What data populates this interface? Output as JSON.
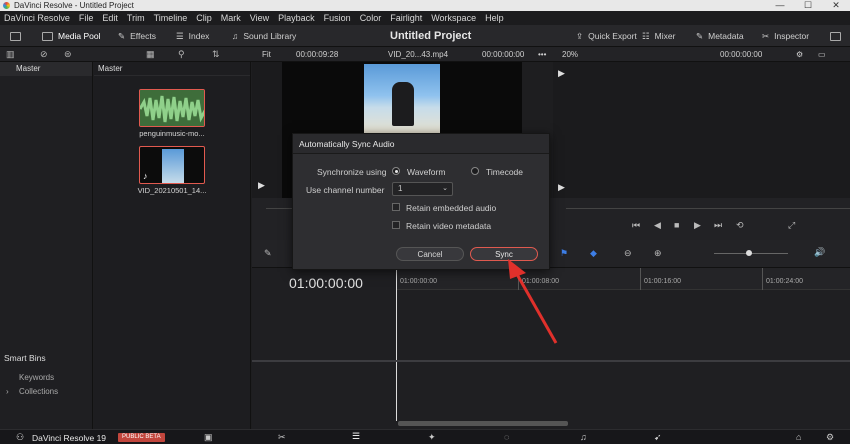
{
  "window": {
    "title": "DaVinci Resolve - Untitled Project"
  },
  "menu": [
    "DaVinci Resolve",
    "File",
    "Edit",
    "Trim",
    "Timeline",
    "Clip",
    "Mark",
    "View",
    "Playback",
    "Fusion",
    "Color",
    "Fairlight",
    "Workspace",
    "Help"
  ],
  "toolbar": {
    "media_pool": "Media Pool",
    "effects": "Effects",
    "index": "Index",
    "sound_library": "Sound Library",
    "project_title": "Untitled Project",
    "quick_export": "Quick Export",
    "mixer": "Mixer",
    "metadata": "Metadata",
    "inspector": "Inspector"
  },
  "subbar": {
    "fit": "Fit",
    "duration": "00:00:09:28",
    "clip_name": "VID_20...43.mp4",
    "source_tc": "00:00:00:00",
    "zoom": "20%",
    "timeline_tc": "00:00:00:00"
  },
  "left_panel": {
    "master": "Master",
    "smart_bins": "Smart Bins",
    "keywords": "Keywords",
    "collections": "Collections"
  },
  "media_pool": {
    "header": "Master",
    "clips": [
      {
        "name": "penguinmusic-mo..."
      },
      {
        "name": "VID_20210501_14..."
      }
    ]
  },
  "timeline": {
    "timecode": "01:00:00:00",
    "ruler": [
      "01:00:00:00",
      "01:00:08:00",
      "01:00:16:00",
      "01:00:24:00"
    ]
  },
  "dialog": {
    "title": "Automatically Sync Audio",
    "sync_label": "Synchronize using",
    "waveform": "Waveform",
    "timecode": "Timecode",
    "channel_label": "Use channel number",
    "channel_value": "1",
    "retain_audio": "Retain embedded audio",
    "retain_video": "Retain video metadata",
    "cancel": "Cancel",
    "sync": "Sync"
  },
  "bottom": {
    "app_name": "DaVinci Resolve 19",
    "badge": "PUBLIC BETA"
  },
  "colors": {
    "accent_red": "#e25a4f",
    "badge_bg": "#c2463d"
  }
}
